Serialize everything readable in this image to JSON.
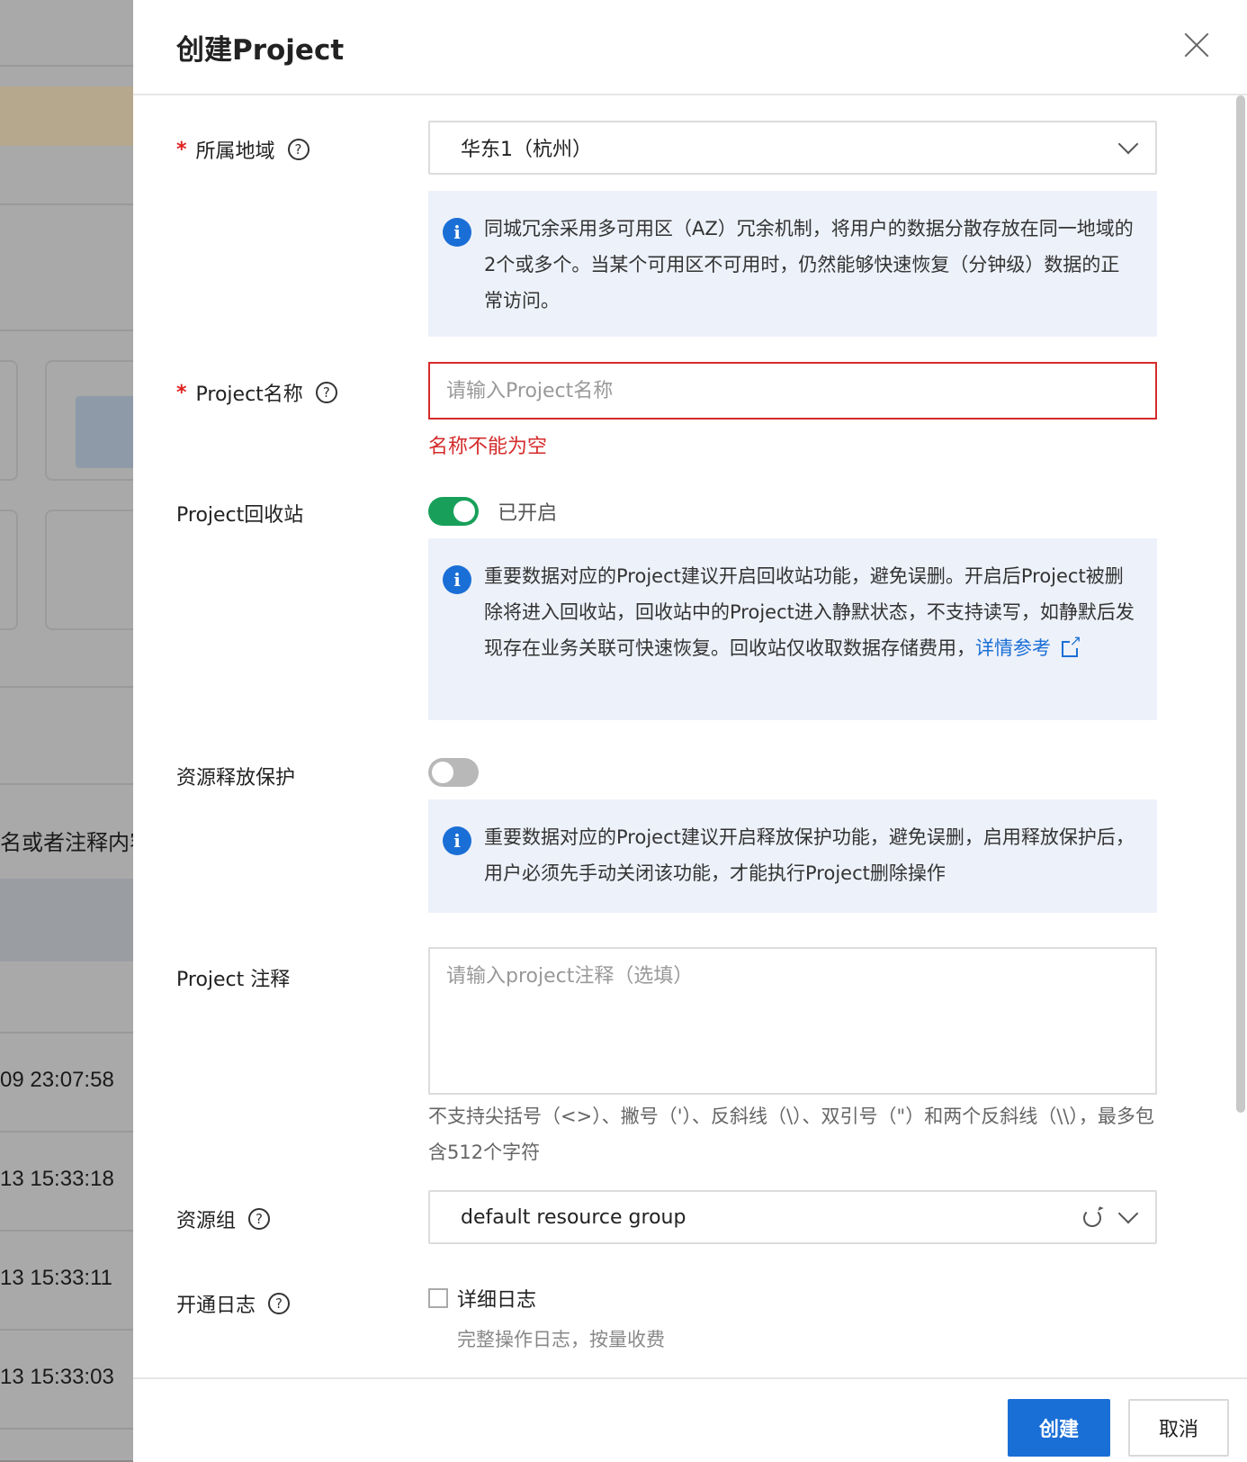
{
  "background": {
    "partial_text": "名或者注释内容搜",
    "timestamps": [
      "09 23:07:58",
      "13 15:33:18",
      "13 15:33:11",
      "13 15:33:03"
    ]
  },
  "drawer": {
    "title": "创建Project",
    "region": {
      "label": "所属地域",
      "value": "华东1（杭州）",
      "info": "同城冗余采用多可用区（AZ）冗余机制，将用户的数据分散存放在同一地域的 2个或多个。当某个可用区不可用时，仍然能够快速恢复（分钟级）数据的正常访问。"
    },
    "name": {
      "label": "Project名称",
      "placeholder": "请输入Project名称",
      "error": "名称不能为空"
    },
    "recycle": {
      "label": "Project回收站",
      "state": "on",
      "state_text": "已开启",
      "info": "重要数据对应的Project建议开启回收站功能，避免误删。开启后Project被删除将进入回收站，回收站中的Project进入静默状态，不支持读写，如静默后发现存在业务关联可快速恢复。回收站仅收取数据存储费用，",
      "link_text": "详情参考"
    },
    "release_protect": {
      "label": "资源释放保护",
      "state": "off",
      "info": "重要数据对应的Project建议开启释放保护功能，避免误删，启用释放保护后，用户必须先手动关闭该功能，才能执行Project删除操作"
    },
    "comment": {
      "label": "Project 注释",
      "placeholder": "请输入project注释（选填）",
      "hint": "不支持尖括号（<>）、撇号（'）、反斜线（\\）、双引号（\"）和两个反斜线（\\\\），最多包含512个字符"
    },
    "resource_group": {
      "label": "资源组",
      "value": "default resource group"
    },
    "log": {
      "label": "开通日志",
      "option": "详细日志",
      "option_hint": "完整操作日志，按量收费"
    },
    "footer": {
      "create": "创建",
      "cancel": "取消"
    }
  },
  "colors": {
    "primary": "#1a6fd6",
    "error": "#d52b2b",
    "toggle_on": "#18a05a",
    "info_bg": "#edf1f9"
  }
}
